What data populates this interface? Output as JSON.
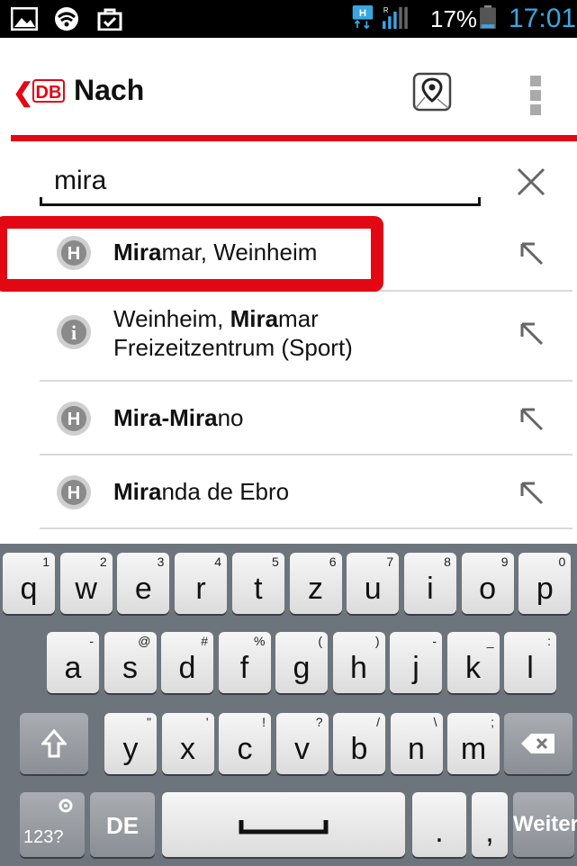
{
  "status_bar": {
    "battery_percent": "17%",
    "time": "17:01",
    "accent_color": "#3aa6e0"
  },
  "app_bar": {
    "logo_text": "DB",
    "title": "Nach",
    "brand_color": "#e30613"
  },
  "search": {
    "value": "mira"
  },
  "suggestions": [
    {
      "icon": "h-stop-icon",
      "bold": "Mira",
      "rest": "mar, Weinheim",
      "line2": ""
    },
    {
      "icon": "info-icon",
      "pre": "Weinheim, ",
      "bold": "Mira",
      "rest": "mar",
      "line2": "Freizeitzentrum (Sport)"
    },
    {
      "icon": "h-stop-icon",
      "bold": "Mira-Mira",
      "rest": "no",
      "line2": ""
    },
    {
      "icon": "h-stop-icon",
      "bold": "Mira",
      "rest": "nda de Ebro",
      "line2": ""
    }
  ],
  "keyboard": {
    "row1": [
      {
        "key": "q",
        "sup": "1"
      },
      {
        "key": "w",
        "sup": "2"
      },
      {
        "key": "e",
        "sup": "3"
      },
      {
        "key": "r",
        "sup": "4"
      },
      {
        "key": "t",
        "sup": "5"
      },
      {
        "key": "z",
        "sup": "6"
      },
      {
        "key": "u",
        "sup": "7"
      },
      {
        "key": "i",
        "sup": "8"
      },
      {
        "key": "o",
        "sup": "9"
      },
      {
        "key": "p",
        "sup": "0"
      }
    ],
    "row2": [
      {
        "key": "a",
        "sup": "-"
      },
      {
        "key": "s",
        "sup": "@"
      },
      {
        "key": "d",
        "sup": "#"
      },
      {
        "key": "f",
        "sup": "%"
      },
      {
        "key": "g",
        "sup": "("
      },
      {
        "key": "h",
        "sup": ")"
      },
      {
        "key": "j",
        "sup": "-"
      },
      {
        "key": "k",
        "sup": "_"
      },
      {
        "key": "l",
        "sup": ":"
      }
    ],
    "row3": [
      {
        "key": "y",
        "sup": "\""
      },
      {
        "key": "x",
        "sup": "'"
      },
      {
        "key": "c",
        "sup": "!"
      },
      {
        "key": "v",
        "sup": "?"
      },
      {
        "key": "b",
        "sup": "/"
      },
      {
        "key": "n",
        "sup": "\\"
      },
      {
        "key": "m",
        "sup": ";"
      }
    ],
    "mode_key": "123?",
    "lang_key": "DE",
    "period_key": ".",
    "comma_key": ",",
    "enter_key": "Weiter"
  }
}
